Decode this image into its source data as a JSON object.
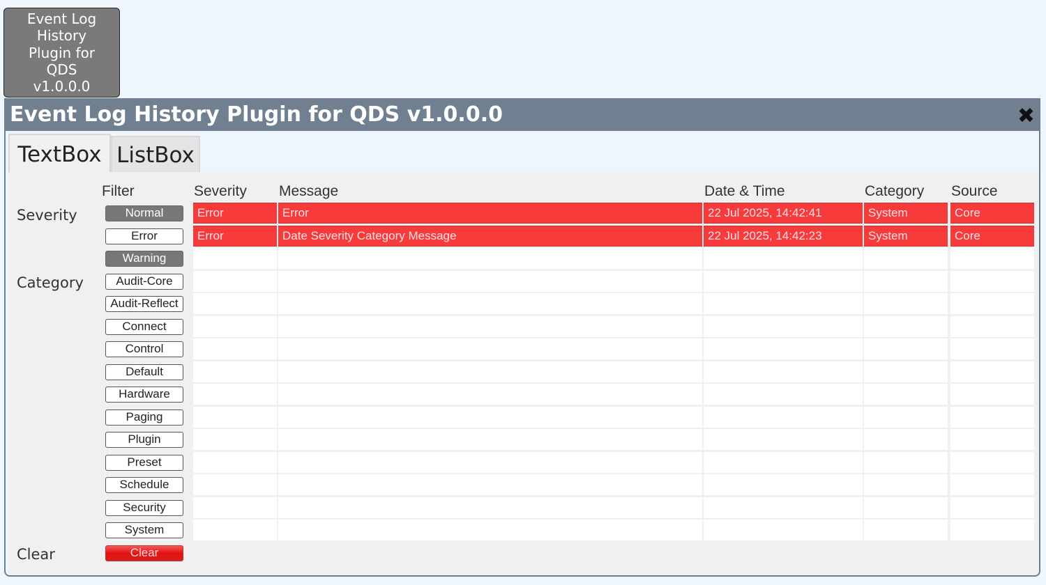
{
  "launcher": {
    "label": "Event Log History Plugin for QDS v1.0.0.0",
    "lines": [
      "Event Log",
      "History",
      "Plugin for",
      "QDS",
      "v1.0.0.0"
    ]
  },
  "window": {
    "title": "Event Log History Plugin for QDS v1.0.0.0",
    "close_icon": "close-icon"
  },
  "tabs": [
    {
      "label": "TextBox",
      "active": true
    },
    {
      "label": "ListBox",
      "active": false
    }
  ],
  "filter": {
    "header": "Filter",
    "severity_label": "Severity",
    "category_label": "Category",
    "clear_label": "Clear",
    "buttons": [
      {
        "label": "Normal",
        "state": "on"
      },
      {
        "label": "Error",
        "state": "off"
      },
      {
        "label": "Warning",
        "state": "on"
      },
      {
        "label": "Audit-Core",
        "state": "off"
      },
      {
        "label": "Audit-Reflect",
        "state": "off"
      },
      {
        "label": "Connect",
        "state": "off"
      },
      {
        "label": "Control",
        "state": "off"
      },
      {
        "label": "Default",
        "state": "off"
      },
      {
        "label": "Hardware",
        "state": "off"
      },
      {
        "label": "Paging",
        "state": "off"
      },
      {
        "label": "Plugin",
        "state": "off"
      },
      {
        "label": "Preset",
        "state": "off"
      },
      {
        "label": "Schedule",
        "state": "off"
      },
      {
        "label": "Security",
        "state": "off"
      },
      {
        "label": "System",
        "state": "off"
      }
    ],
    "clear_button": "Clear"
  },
  "table": {
    "columns": [
      "Severity",
      "Message",
      "Date & Time",
      "Category",
      "Source"
    ],
    "rows": [
      [
        "Error",
        "Error",
        "22 Jul 2025, 14:42:41",
        "System",
        "Core"
      ],
      [
        "Error",
        "Date Severity Category Message",
        "22 Jul 2025, 14:42:23",
        "System",
        "Core"
      ]
    ],
    "empty_rows": 13
  },
  "colors": {
    "titlebar": "#708090",
    "error_row": "#f73b3b",
    "active_filter": "#777777",
    "clear": "#e41010"
  }
}
